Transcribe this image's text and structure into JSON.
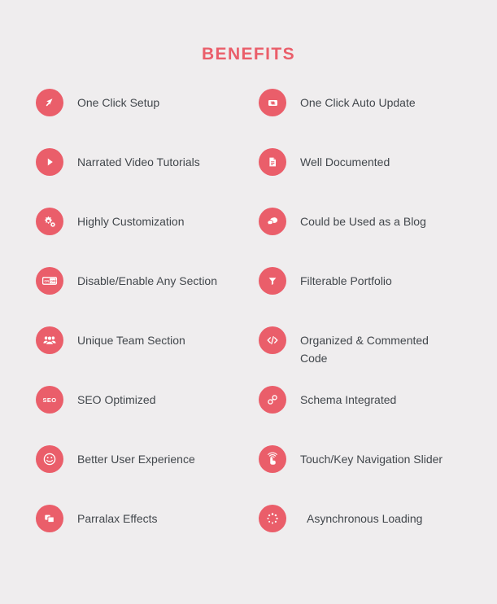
{
  "meta": {
    "background_color": "#efedee",
    "accent_color": "#ea5e6a",
    "text_color": "#42474c"
  },
  "header": {
    "title": "BENEFITS"
  },
  "rows": [
    {
      "left": {
        "icon": "cursor-arrow-icon",
        "label": "One Click Setup"
      },
      "right": {
        "icon": "refresh-update-icon",
        "label": "One Click Auto Update"
      }
    },
    {
      "left": {
        "icon": "play-button-icon",
        "label": "Narrated Video Tutorials"
      },
      "right": {
        "icon": "document-icon",
        "label": "Well Documented"
      }
    },
    {
      "left": {
        "icon": "gears-icon",
        "label": "Highly Customization"
      },
      "right": {
        "icon": "chat-bubble-icon",
        "label": "Could be Used as a Blog"
      }
    },
    {
      "left": {
        "icon": "on-off-toggle-icon",
        "label": "Disable/Enable Any Section",
        "on_label": "ON",
        "off_label": "OFF"
      },
      "right": {
        "icon": "funnel-filter-icon",
        "label": "Filterable Portfolio"
      }
    },
    {
      "left": {
        "icon": "team-people-icon",
        "label": "Unique Team Section"
      },
      "right": {
        "icon": "code-tag-icon",
        "label": "Organized & Commented\nCode"
      }
    },
    {
      "left": {
        "icon": "seo-text-icon",
        "label": "SEO Optimized",
        "glyph_text": "SEO"
      },
      "right": {
        "icon": "chain-link-icon",
        "label": "Schema Integrated"
      }
    },
    {
      "left": {
        "icon": "smiley-face-icon",
        "label": "Better User Experience"
      },
      "right": {
        "icon": "touch-gesture-icon",
        "label": "Touch/Key Navigation Slider"
      }
    },
    {
      "left": {
        "icon": "layers-stack-icon",
        "label": "Parralax Effects"
      },
      "right": {
        "icon": "loading-spinner-icon",
        "label": "Asynchronous Loading"
      }
    }
  ]
}
